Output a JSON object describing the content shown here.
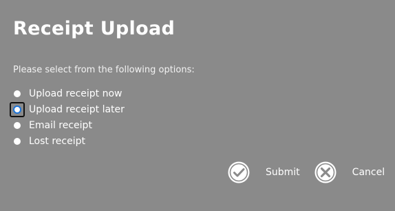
{
  "dialog": {
    "title": "Receipt Upload",
    "prompt": "Please select from the following options:",
    "options": [
      {
        "label": "Upload receipt now",
        "selected": false
      },
      {
        "label": "Upload receipt later",
        "selected": true
      },
      {
        "label": "Email receipt",
        "selected": false
      },
      {
        "label": "Lost receipt",
        "selected": false
      }
    ],
    "actions": {
      "submit_label": "Submit",
      "cancel_label": "Cancel"
    }
  },
  "colors": {
    "background": "#8a8a8a",
    "text": "#ffffff",
    "focus_ring": "#101010",
    "selected_accent": "#1a73d9"
  },
  "icons": {
    "submit": "checkmark-circle-icon",
    "cancel": "x-circle-icon"
  }
}
